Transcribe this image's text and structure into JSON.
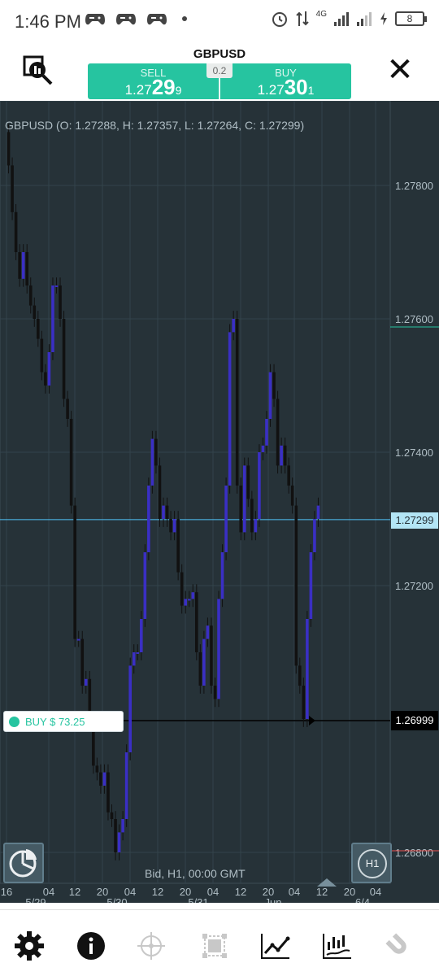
{
  "status_bar": {
    "time": "1:46 PM",
    "network": "4G",
    "battery": "8"
  },
  "header": {
    "symbol": "GBPUSD",
    "spread": "0.2",
    "sell": {
      "label": "SELL",
      "price_prefix": "1.27",
      "price_big": "29",
      "price_suffix": "9"
    },
    "buy": {
      "label": "BUY",
      "price_prefix": "1.27",
      "price_big": "30",
      "price_suffix": "1"
    }
  },
  "chart": {
    "ohlc_text": "GBPUSD (O: 1.27288, H: 1.27357, L: 1.27264, C: 1.27299)",
    "footer_text": "Bid, H1, 00:00 GMT",
    "price_labels": [
      "1.27800",
      "1.27600",
      "1.27400",
      "1.27200",
      "1.26800"
    ],
    "current_price": "1.27299",
    "trade_price": "1.26999",
    "trade_label": "BUY $ 73.25",
    "x_labels_top": [
      "16",
      "04",
      "12",
      "20",
      "04",
      "12",
      "20",
      "04",
      "12",
      "20",
      "04",
      "12",
      "20",
      "04"
    ],
    "x_labels_bottom": [
      "5/29",
      "5/30",
      "5/31",
      "Jun",
      "6/4"
    ],
    "timeframe": "H1"
  },
  "colors": {
    "accent": "#26c4a0",
    "chart_bg": "#263238",
    "candle": "#3a2fc4",
    "grid": "#33434b"
  },
  "toolbar": [
    "gear-icon",
    "info-icon",
    "crosshair-icon",
    "object-select-icon",
    "line-chart-icon",
    "indicators-icon",
    "magnet-icon"
  ]
}
